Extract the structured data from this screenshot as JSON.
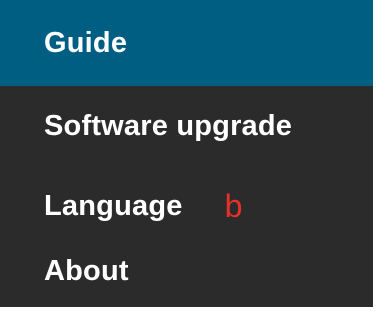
{
  "menu": {
    "items": [
      {
        "label": "Guide",
        "active": true
      },
      {
        "label": "Software upgrade",
        "active": false
      },
      {
        "label": "Language",
        "active": false
      },
      {
        "label": "About",
        "active": false
      }
    ],
    "annotation": "b"
  },
  "colors": {
    "menu_background": "#2b2b2b",
    "active_item_background": "#005e83",
    "item_text": "#ffffff",
    "annotation_text": "#e8302a"
  }
}
